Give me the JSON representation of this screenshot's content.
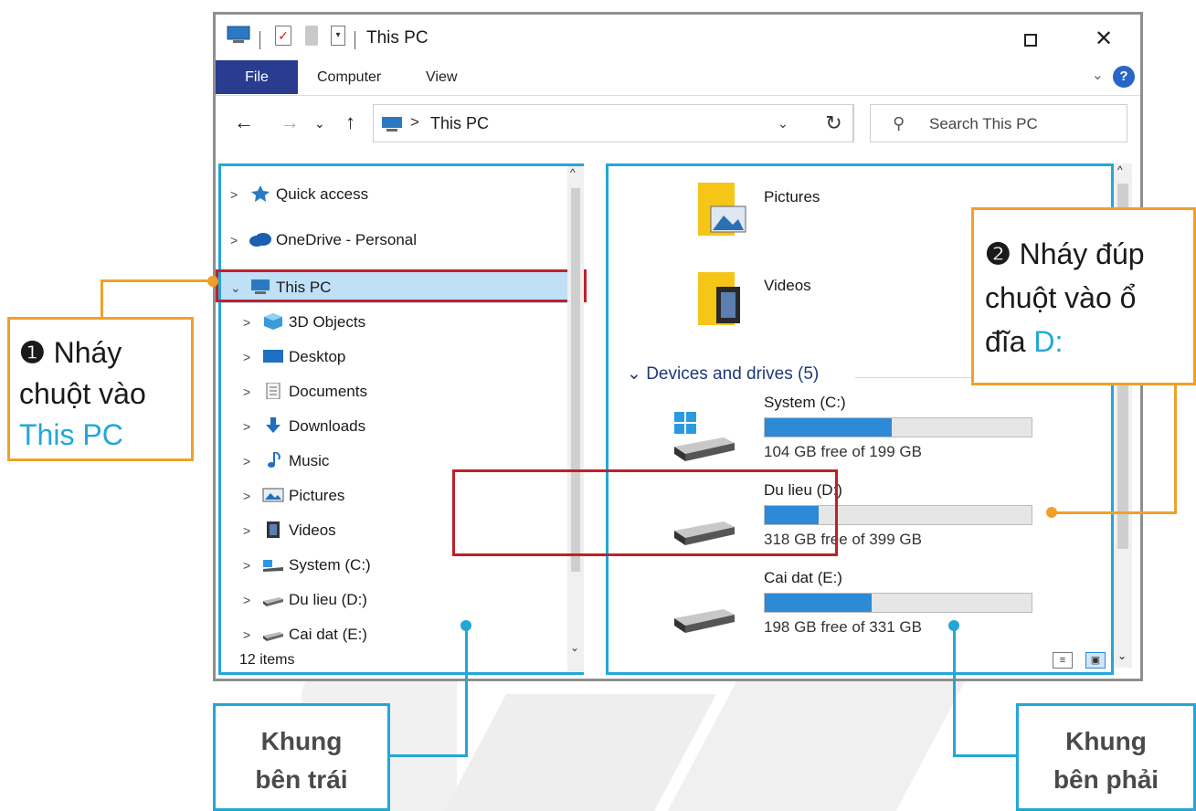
{
  "window": {
    "title": "This PC",
    "qat_check": "✓",
    "qat_drop": "▾",
    "close": "✕"
  },
  "ribbon": {
    "tabs": [
      "File",
      "Computer",
      "View"
    ],
    "collapse": "⌄",
    "help": "?"
  },
  "nav": {
    "back": "←",
    "forward": "→",
    "recent": "⌄",
    "up": "↑",
    "breadcrumb_sep": ">",
    "address": "This PC",
    "address_drop": "⌄",
    "refresh": "↻",
    "search_placeholder": "Search This PC",
    "search_glyph": "⚲"
  },
  "tree": {
    "items": [
      {
        "label": "Quick access",
        "chev": ">"
      },
      {
        "label": "OneDrive - Personal",
        "chev": ">"
      },
      {
        "label": "This PC",
        "chev": "⌄"
      },
      {
        "label": "3D Objects",
        "chev": ">"
      },
      {
        "label": "Desktop",
        "chev": ">"
      },
      {
        "label": "Documents",
        "chev": ">"
      },
      {
        "label": "Downloads",
        "chev": ">"
      },
      {
        "label": "Music",
        "chev": ">"
      },
      {
        "label": "Pictures",
        "chev": ">"
      },
      {
        "label": "Videos",
        "chev": ">"
      },
      {
        "label": "System (C:)",
        "chev": ">"
      },
      {
        "label": "Du lieu (D:)",
        "chev": ">"
      },
      {
        "label": "Cai dat (E:)",
        "chev": ">"
      }
    ],
    "scroll_up": "^",
    "scroll_down": "⌄"
  },
  "status": {
    "count": "12 items"
  },
  "content": {
    "folders": [
      "Pictures",
      "Videos"
    ],
    "group_heading": "Devices and drives (5)",
    "group_chev": "⌄",
    "drives": [
      {
        "name": "System (C:)",
        "free": "104 GB free of 199 GB",
        "used_fraction": 0.477
      },
      {
        "name": "Du lieu (D:)",
        "free": "318 GB free of 399 GB",
        "used_fraction": 0.203
      },
      {
        "name": "Cai dat (E:)",
        "free": "198 GB free of 331 GB",
        "used_fraction": 0.402
      }
    ],
    "scroll_up": "^",
    "scroll_down": "⌄"
  },
  "callouts": {
    "step1_num": "❶",
    "step1_lines": [
      "Nháy",
      "chuột vào"
    ],
    "step1_highlight": "This PC",
    "step2_num": "❷",
    "step2_lines": [
      "Nháy đúp",
      "chuột vào ổ",
      "đĩa"
    ],
    "step2_highlight": "D:"
  },
  "labels": {
    "left_pane": [
      "Khung",
      "bên trái"
    ],
    "right_pane": [
      "Khung",
      "bên phải"
    ]
  },
  "colors": {
    "accent_blue": "#22a7d8",
    "callout_orange": "#f0a02a",
    "highlight_red": "#c0202a",
    "file_tab": "#2a3c8f",
    "drive_fill": "#2d8ad6"
  }
}
